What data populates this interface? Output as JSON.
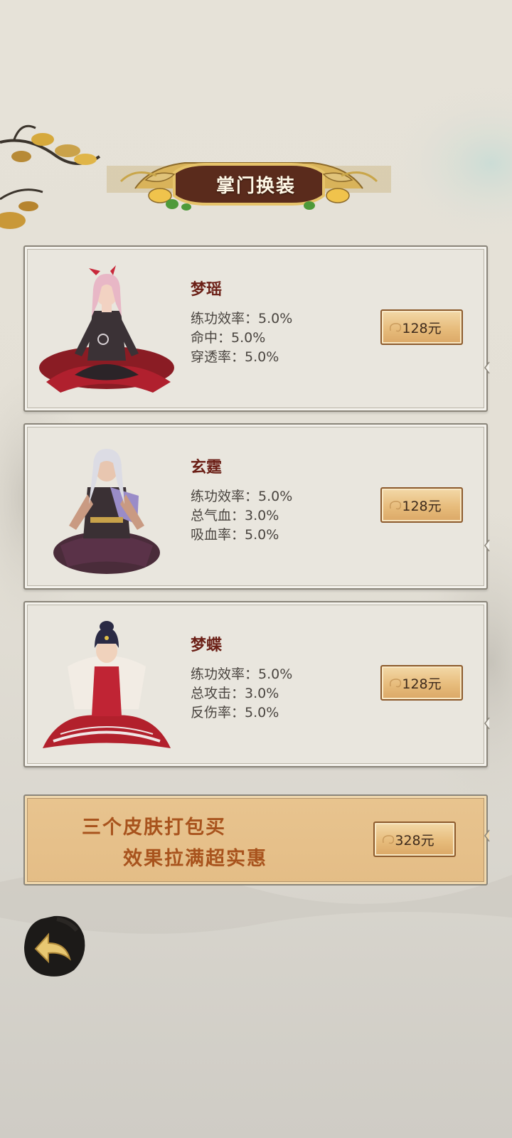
{
  "header": {
    "title": "掌门换装"
  },
  "skins": [
    {
      "name": "梦瑶",
      "stats": [
        "练功效率：5.0%",
        "命中：5.0%",
        "穿透率：5.0%"
      ],
      "price": "128元",
      "icon": "character-mengyao"
    },
    {
      "name": "玄霆",
      "stats": [
        "练功效率：5.0%",
        "总气血：3.0%",
        "吸血率：5.0%"
      ],
      "price": "128元",
      "icon": "character-xuanting"
    },
    {
      "name": "梦蝶",
      "stats": [
        "练功效率：5.0%",
        "总攻击：3.0%",
        "反伤率：5.0%"
      ],
      "price": "128元",
      "icon": "character-mengdie"
    }
  ],
  "bundle": {
    "line1": "三个皮肤打包买",
    "line2": "效果拉满超实惠",
    "price": "328元"
  },
  "navigation": {
    "back_icon": "back-arrow-icon"
  },
  "colors": {
    "name_text": "#6b1f16",
    "bundle_text": "#a8531d",
    "button_fill": "#e7bc7c",
    "banner_brown": "#5a2b1c",
    "banner_gold": "#d9b35a"
  }
}
